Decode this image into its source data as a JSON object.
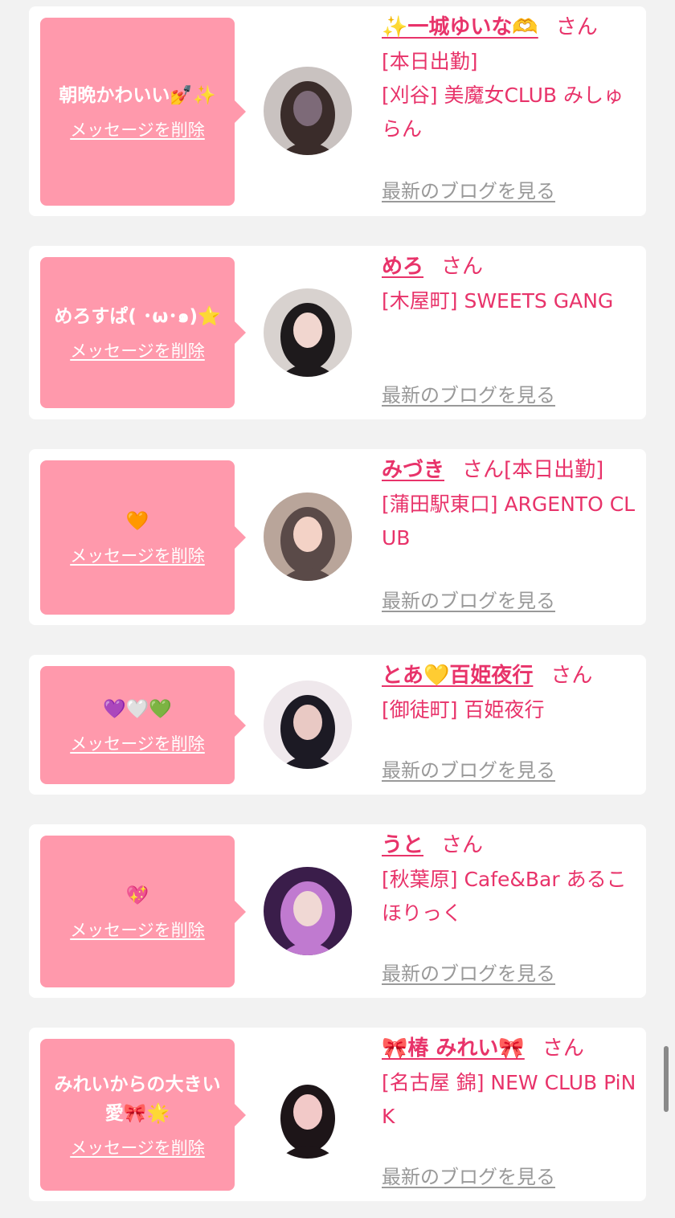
{
  "cards": [
    {
      "message": "朝晩かわいい💅✨",
      "delete_label": "メッセージを削除",
      "name": "✨一城ゆいな🫶",
      "suffix": "さん",
      "shop": "[本日出勤]\n[刈谷] 美魔女CLUB みしゅらん",
      "blog_label": "最新のブログを見る",
      "avatar_icon": "avatar-photo",
      "avatar_colors": [
        "#c9c2c0",
        "#3a2c2a",
        "#7d6a78"
      ]
    },
    {
      "message": "めろすぱ( ･ω･๑)⭐",
      "delete_label": "メッセージを削除",
      "name": "めろ",
      "suffix": "さん",
      "shop": "[木屋町] SWEETS GANG",
      "blog_label": "最新のブログを見る",
      "avatar_icon": "avatar-photo",
      "avatar_colors": [
        "#d8d2cf",
        "#1e1a1c",
        "#f1d6cf"
      ]
    },
    {
      "message": "🧡",
      "delete_label": "メッセージを削除",
      "name": "みづき",
      "suffix": "さん[本日出勤]",
      "shop": "[蒲田駅東口] ARGENTO CLUB",
      "blog_label": "最新のブログを見る",
      "avatar_icon": "avatar-photo",
      "avatar_colors": [
        "#b9a59a",
        "#5a4a48",
        "#f3d2c6"
      ]
    },
    {
      "message": "💜🤍💚",
      "delete_label": "メッセージを削除",
      "name": "とあ💛百姫夜行",
      "suffix": "さん",
      "shop": "[御徒町] 百姫夜行",
      "blog_label": "最新のブログを見る",
      "avatar_icon": "avatar-photo",
      "avatar_colors": [
        "#efe8ec",
        "#1c1a24",
        "#e9c9c4"
      ]
    },
    {
      "message": "💖",
      "delete_label": "メッセージを削除",
      "name": "うと",
      "suffix": "さん",
      "shop": "[秋葉原] Cafe&Bar あるこほりっく",
      "blog_label": "最新のブログを見る",
      "avatar_icon": "avatar-photo",
      "avatar_colors": [
        "#3a1d4a",
        "#c07ad0",
        "#f0d8d4"
      ]
    },
    {
      "message": "みれいからの大きい愛🎀🌟",
      "delete_label": "メッセージを削除",
      "name": "🎀椿 みれい🎀",
      "suffix": "さん",
      "shop": "[名古屋 錦] NEW CLUB PiNK",
      "blog_label": "最新のブログを見る",
      "avatar_icon": "avatar-photo",
      "avatar_colors": [
        "#ffffff",
        "#1d1518",
        "#f2c9c8"
      ]
    }
  ]
}
